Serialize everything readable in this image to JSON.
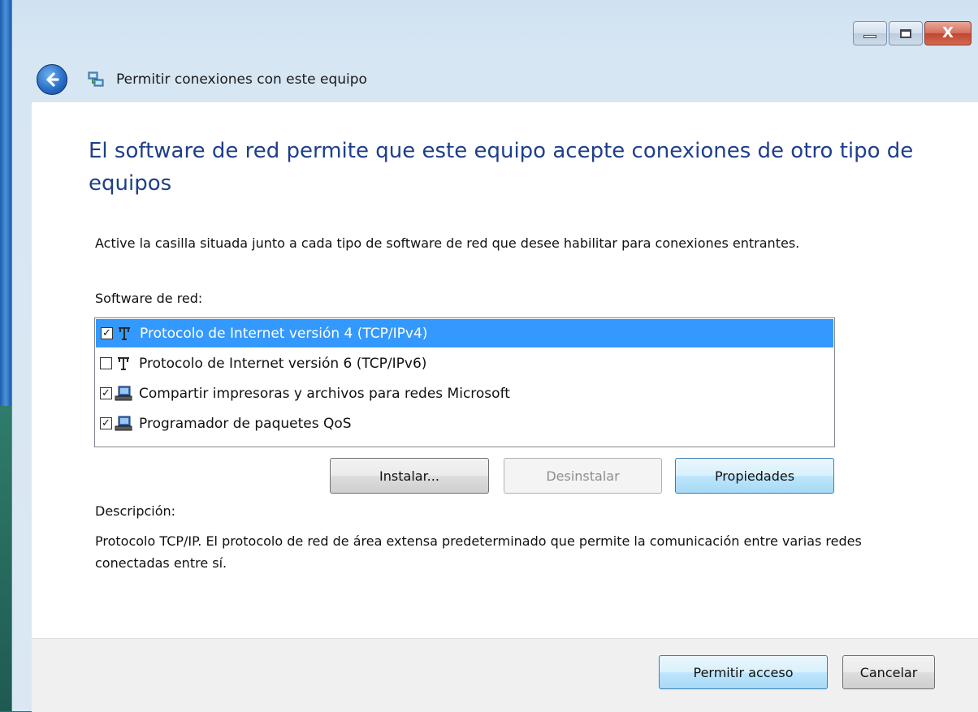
{
  "window": {
    "nav_title": "Permitir conexiones con este equipo",
    "caption": {
      "close_glyph": "X"
    }
  },
  "main": {
    "heading": "El software de red permite que este equipo acepte conexiones de otro tipo de equipos",
    "instruction": "Active la casilla situada junto a cada tipo de software de red que desee habilitar para conexiones entrantes.",
    "software_label": "Software de red:",
    "software_items": [
      {
        "label": "Protocolo de Internet versión 4 (TCP/IPv4)",
        "checked": true,
        "selected": true,
        "icon": "protocol-icon"
      },
      {
        "label": "Protocolo de Internet versión 6 (TCP/IPv6)",
        "checked": false,
        "selected": false,
        "icon": "protocol-icon"
      },
      {
        "label": "Compartir impresoras y archivos para redes Microsoft",
        "checked": true,
        "selected": false,
        "icon": "network-service-icon"
      },
      {
        "label": "Programador de paquetes QoS",
        "checked": true,
        "selected": false,
        "icon": "network-service-icon"
      }
    ],
    "buttons": {
      "install": "Instalar...",
      "uninstall": "Desinstalar",
      "properties": "Propiedades"
    },
    "description_label": "Descripción:",
    "description_text": "Protocolo TCP/IP. El protocolo de red de área extensa predeterminado que permite la comunicación entre varias redes conectadas entre sí."
  },
  "footer": {
    "allow_access": "Permitir acceso",
    "cancel": "Cancelar"
  },
  "colors": {
    "heading": "#1e3f8a",
    "selection": "#3399ff"
  }
}
